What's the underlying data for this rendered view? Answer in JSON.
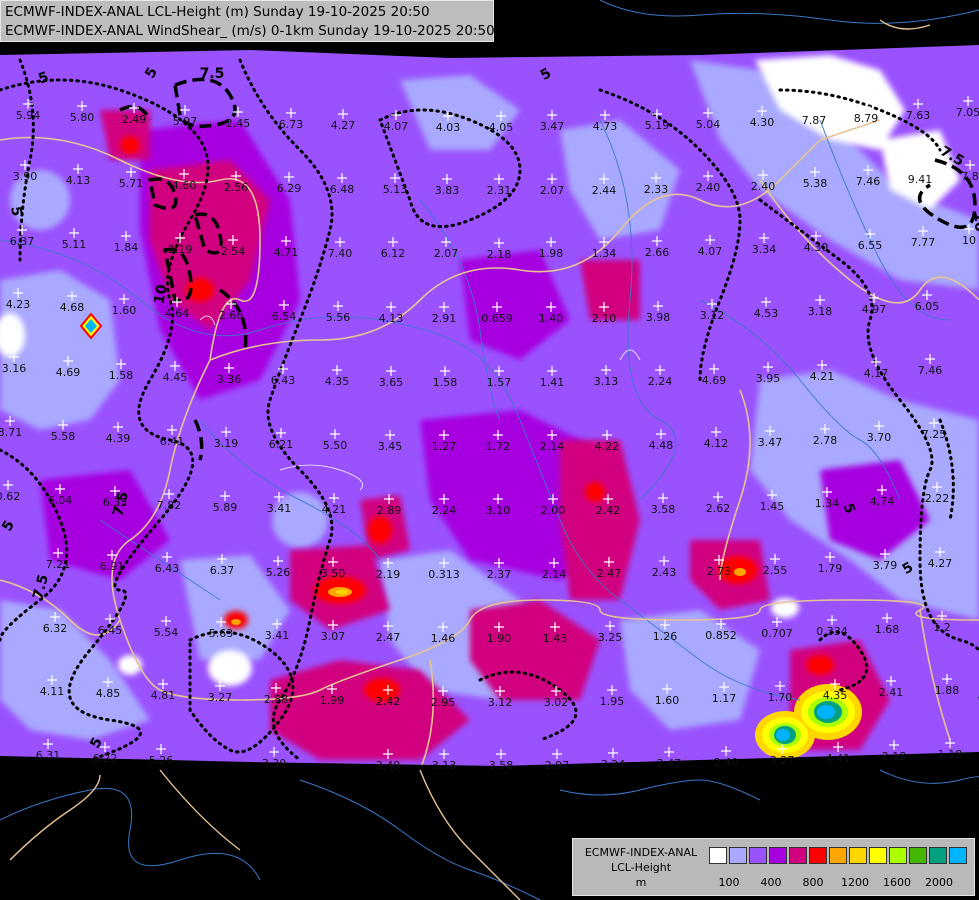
{
  "header": {
    "line1": "ECMWF-INDEX-ANAL LCL-Height (m) Sunday 19-10-2025 20:50",
    "line2": "ECMWF-INDEX-ANAL WindShear_ (m/s) 0-1km Sunday 19-10-2025 20:50"
  },
  "legend": {
    "line1": "ECMWF-INDEX-ANAL",
    "line2": "LCL-Height",
    "line3": "m",
    "ticks": [
      "100",
      "400",
      "800",
      "1200",
      "1600",
      "2000"
    ],
    "colors": [
      "#ffffff",
      "#a9a9ff",
      "#9a52ff",
      "#a600e0",
      "#d1007f",
      "#ff0000",
      "#ffa500",
      "#ffd700",
      "#ffff00",
      "#aaff00",
      "#44b800",
      "#00a080",
      "#00b4ff"
    ]
  },
  "contour_labels": [
    "5",
    "5",
    "5",
    "5",
    "7.5",
    "7.5",
    "7.5",
    "7.5",
    "10",
    "10",
    "5",
    "5",
    "5",
    "5"
  ],
  "stations": [
    [
      "5.94",
      28,
      115
    ],
    [
      "5.80",
      82,
      117
    ],
    [
      "2.49",
      134,
      119
    ],
    [
      "5.97",
      185,
      121
    ],
    [
      "2.45",
      238,
      123
    ],
    [
      "6.73",
      291,
      124
    ],
    [
      "4.27",
      343,
      125
    ],
    [
      "4.07",
      396,
      126
    ],
    [
      "4.03",
      448,
      127
    ],
    [
      "4.05",
      501,
      127
    ],
    [
      "3.47",
      552,
      126
    ],
    [
      "4.73",
      605,
      126
    ],
    [
      "5.19",
      657,
      125
    ],
    [
      "5.04",
      708,
      124
    ],
    [
      "4.30",
      762,
      122
    ],
    [
      "7.87",
      814,
      120
    ],
    [
      "8.79",
      866,
      118
    ],
    [
      "7.63",
      918,
      115
    ],
    [
      "7.05",
      968,
      112
    ],
    [
      "3.90",
      25,
      176
    ],
    [
      "4.13",
      78,
      180
    ],
    [
      "5.71",
      131,
      183
    ],
    [
      "4.60",
      184,
      185
    ],
    [
      "2.56",
      236,
      187
    ],
    [
      "6.29",
      289,
      188
    ],
    [
      "6.48",
      342,
      189
    ],
    [
      "5.13",
      395,
      189
    ],
    [
      "3.83",
      447,
      190
    ],
    [
      "2.31",
      499,
      190
    ],
    [
      "2.07",
      552,
      190
    ],
    [
      "2.44",
      604,
      190
    ],
    [
      "2.33",
      656,
      189
    ],
    [
      "2.40",
      708,
      187
    ],
    [
      "2.40",
      763,
      186
    ],
    [
      "5.38",
      815,
      183
    ],
    [
      "7.46",
      868,
      181
    ],
    [
      "9.41",
      920,
      179
    ],
    [
      "7.8",
      970,
      176
    ],
    [
      "6.37",
      22,
      241
    ],
    [
      "5.11",
      74,
      244
    ],
    [
      "1.84",
      126,
      247
    ],
    [
      "2.19",
      180,
      249
    ],
    [
      "2.54",
      233,
      251
    ],
    [
      "4.71",
      286,
      252
    ],
    [
      "7.40",
      340,
      253
    ],
    [
      "6.12",
      393,
      253
    ],
    [
      "2.07",
      446,
      253
    ],
    [
      "2.18",
      499,
      254
    ],
    [
      "1.98",
      551,
      253
    ],
    [
      "1.34",
      604,
      253
    ],
    [
      "2.66",
      657,
      252
    ],
    [
      "4.07",
      710,
      251
    ],
    [
      "3.34",
      764,
      249
    ],
    [
      "4.30",
      816,
      247
    ],
    [
      "6.55",
      870,
      245
    ],
    [
      "7.77",
      923,
      242
    ],
    [
      "10",
      969,
      240
    ],
    [
      "4.23",
      18,
      304
    ],
    [
      "4.68",
      72,
      307
    ],
    [
      "1.60",
      124,
      310
    ],
    [
      "4.64",
      177,
      313
    ],
    [
      "2.66",
      231,
      315
    ],
    [
      "6.54",
      284,
      316
    ],
    [
      "5.56",
      338,
      317
    ],
    [
      "4.13",
      391,
      318
    ],
    [
      "2.91",
      444,
      318
    ],
    [
      "0.659",
      497,
      318
    ],
    [
      "1.40",
      551,
      318
    ],
    [
      "2.10",
      604,
      318
    ],
    [
      "3.98",
      658,
      317
    ],
    [
      "3.12",
      712,
      315
    ],
    [
      "4.53",
      766,
      313
    ],
    [
      "3.18",
      820,
      311
    ],
    [
      "4.97",
      874,
      309
    ],
    [
      "6.05",
      927,
      306
    ],
    [
      "3.16",
      14,
      368
    ],
    [
      "4.69",
      68,
      372
    ],
    [
      "1.58",
      121,
      375
    ],
    [
      "4.45",
      175,
      377
    ],
    [
      "3.36",
      229,
      379
    ],
    [
      "6.43",
      283,
      380
    ],
    [
      "4.35",
      337,
      381
    ],
    [
      "3.65",
      391,
      382
    ],
    [
      "1.58",
      445,
      382
    ],
    [
      "1.57",
      499,
      382
    ],
    [
      "1.41",
      552,
      382
    ],
    [
      "3.13",
      606,
      381
    ],
    [
      "2.24",
      660,
      381
    ],
    [
      "4.69",
      714,
      380
    ],
    [
      "3.95",
      768,
      378
    ],
    [
      "4.21",
      822,
      376
    ],
    [
      "4.17",
      876,
      373
    ],
    [
      "7.46",
      930,
      370
    ],
    [
      "3.71",
      10,
      432
    ],
    [
      "5.58",
      63,
      436
    ],
    [
      "4.39",
      118,
      438
    ],
    [
      "6.41",
      172,
      441
    ],
    [
      "3.19",
      226,
      443
    ],
    [
      "6.21",
      281,
      444
    ],
    [
      "5.50",
      335,
      445
    ],
    [
      "3.45",
      390,
      446
    ],
    [
      "1.27",
      444,
      446
    ],
    [
      "1.72",
      498,
      446
    ],
    [
      "2.14",
      552,
      446
    ],
    [
      "4.22",
      607,
      446
    ],
    [
      "4.48",
      661,
      445
    ],
    [
      "4.12",
      716,
      443
    ],
    [
      "3.47",
      770,
      442
    ],
    [
      "2.78",
      825,
      440
    ],
    [
      "3.70",
      879,
      437
    ],
    [
      "7.25",
      934,
      434
    ],
    [
      "6.04",
      60,
      500
    ],
    [
      "6.35",
      115,
      502
    ],
    [
      "7.82",
      169,
      505
    ],
    [
      "5.89",
      225,
      507
    ],
    [
      "3.41",
      279,
      508
    ],
    [
      "4.21",
      334,
      509
    ],
    [
      "2.89",
      389,
      510
    ],
    [
      "2.24",
      444,
      510
    ],
    [
      "3.10",
      498,
      510
    ],
    [
      "2.00",
      553,
      510
    ],
    [
      "2.42",
      608,
      510
    ],
    [
      "3.58",
      663,
      509
    ],
    [
      "2.62",
      718,
      508
    ],
    [
      "1.45",
      772,
      506
    ],
    [
      "1.34",
      827,
      503
    ],
    [
      "4.74",
      882,
      501
    ],
    [
      "2.22",
      937,
      498
    ],
    [
      "0.62",
      8,
      496
    ],
    [
      "7.21",
      58,
      564
    ],
    [
      "6.91",
      112,
      566
    ],
    [
      "6.43",
      167,
      568
    ],
    [
      "6.37",
      222,
      570
    ],
    [
      "5.26",
      278,
      572
    ],
    [
      "3.50",
      333,
      573
    ],
    [
      "2.19",
      388,
      574
    ],
    [
      "0.313",
      444,
      574
    ],
    [
      "2.37",
      499,
      574
    ],
    [
      "2.14",
      554,
      574
    ],
    [
      "2.47",
      609,
      573
    ],
    [
      "2.43",
      664,
      572
    ],
    [
      "2.73",
      719,
      571
    ],
    [
      "2.55",
      775,
      570
    ],
    [
      "1.79",
      830,
      568
    ],
    [
      "3.79",
      885,
      565
    ],
    [
      "4.27",
      940,
      563
    ],
    [
      "6.32",
      55,
      628
    ],
    [
      "6.45",
      110,
      630
    ],
    [
      "5.54",
      166,
      632
    ],
    [
      "5.63",
      221,
      633
    ],
    [
      "3.41",
      277,
      635
    ],
    [
      "3.07",
      333,
      636
    ],
    [
      "2.47",
      388,
      637
    ],
    [
      "1.46",
      443,
      638
    ],
    [
      "1.90",
      499,
      638
    ],
    [
      "1.43",
      555,
      638
    ],
    [
      "3.25",
      610,
      637
    ],
    [
      "1.26",
      665,
      636
    ],
    [
      "0.852",
      721,
      635
    ],
    [
      "0.707",
      777,
      633
    ],
    [
      "0.334",
      832,
      631
    ],
    [
      "1.68",
      887,
      629
    ],
    [
      "1.2",
      942,
      627
    ],
    [
      "4.11",
      52,
      691
    ],
    [
      "4.85",
      108,
      693
    ],
    [
      "4.81",
      163,
      695
    ],
    [
      "3.27",
      220,
      697
    ],
    [
      "2.88",
      276,
      699
    ],
    [
      "1.99",
      332,
      700
    ],
    [
      "2.42",
      388,
      701
    ],
    [
      "2.95",
      443,
      702
    ],
    [
      "3.12",
      500,
      702
    ],
    [
      "3.02",
      556,
      702
    ],
    [
      "1.95",
      612,
      701
    ],
    [
      "1.60",
      667,
      700
    ],
    [
      "1.17",
      724,
      698
    ],
    [
      "1.70",
      780,
      697
    ],
    [
      "4.35",
      835,
      695
    ],
    [
      "2.41",
      891,
      692
    ],
    [
      "1.88",
      947,
      690
    ],
    [
      "6.31",
      48,
      755
    ],
    [
      "6.22",
      105,
      758
    ],
    [
      "5.26",
      161,
      760
    ],
    [
      "3.30",
      274,
      763
    ],
    [
      "3.40",
      388,
      765
    ],
    [
      "3.13",
      444,
      765
    ],
    [
      "3.58",
      501,
      765
    ],
    [
      "2.97",
      557,
      765
    ],
    [
      "3.24",
      613,
      764
    ],
    [
      "2.47",
      669,
      763
    ],
    [
      "2.40",
      726,
      762
    ],
    [
      "3.27",
      782,
      760
    ],
    [
      "4.41",
      838,
      758
    ],
    [
      "2.18",
      894,
      756
    ],
    [
      "1.18",
      950,
      754
    ]
  ]
}
